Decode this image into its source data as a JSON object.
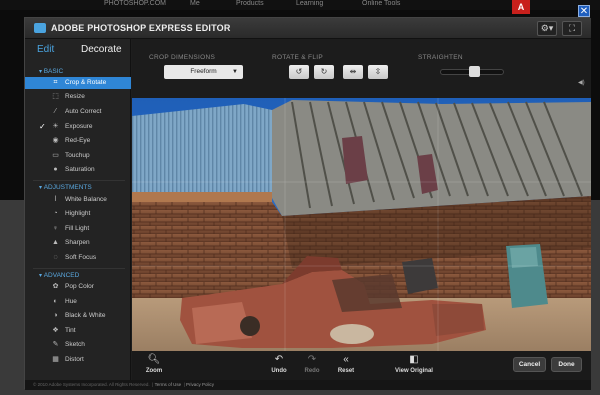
{
  "site": {
    "nav": [
      "PHOTOSHOP.COM",
      "Me",
      "Products",
      "Learning",
      "Online Tools"
    ]
  },
  "window": {
    "title": "ADOBE PHOTOSHOP EXPRESS EDITOR",
    "close_glyph": "✕"
  },
  "sidebar": {
    "tabs": {
      "edit": "Edit",
      "decorate": "Decorate"
    },
    "sections": {
      "basic": "BASIC",
      "adjustments": "ADJUSTMENTS",
      "advanced": "ADVANCED"
    },
    "basic_items": [
      {
        "label": "Crop & Rotate",
        "icon": "crop-icon"
      },
      {
        "label": "Resize",
        "icon": "resize-icon"
      },
      {
        "label": "Auto Correct",
        "icon": "wand-icon"
      },
      {
        "label": "Exposure",
        "icon": "sun-icon"
      },
      {
        "label": "Red-Eye",
        "icon": "eye-icon"
      },
      {
        "label": "Touchup",
        "icon": "bandage-icon"
      },
      {
        "label": "Saturation",
        "icon": "drop-icon"
      }
    ],
    "adjustment_items": [
      {
        "label": "White Balance",
        "icon": "thermometer-icon"
      },
      {
        "label": "Highlight",
        "icon": "highlight-icon"
      },
      {
        "label": "Fill Light",
        "icon": "bulb-icon"
      },
      {
        "label": "Sharpen",
        "icon": "triangle-icon"
      },
      {
        "label": "Soft Focus",
        "icon": "blur-icon"
      }
    ],
    "advanced_items": [
      {
        "label": "Pop Color",
        "icon": "palette-icon"
      },
      {
        "label": "Hue",
        "icon": "hue-icon"
      },
      {
        "label": "Black & White",
        "icon": "bw-icon"
      },
      {
        "label": "Tint",
        "icon": "tint-icon"
      },
      {
        "label": "Sketch",
        "icon": "pencil-icon"
      },
      {
        "label": "Distort",
        "icon": "distort-icon"
      }
    ],
    "selected": "Crop & Rotate",
    "checked": "Exposure"
  },
  "options": {
    "crop_label": "CROP DIMENSIONS",
    "crop_value": "Freeform",
    "rotate_label": "ROTATE & FLIP",
    "straighten_label": "STRAIGHTEN",
    "straighten_level": 0.5
  },
  "bottombar": {
    "zoom": "Zoom",
    "undo": "Undo",
    "redo": "Redo",
    "reset": "Reset",
    "view_original": "View Original",
    "cancel": "Cancel",
    "done": "Done"
  },
  "footer": {
    "copyright": "© 2010 Adobe Systems Incorporated. All Rights Reserved.",
    "terms": "Terms of Use",
    "privacy": "Privacy Policy"
  },
  "colors": {
    "accent": "#2f86d6",
    "section_head": "#5aa8e0"
  }
}
